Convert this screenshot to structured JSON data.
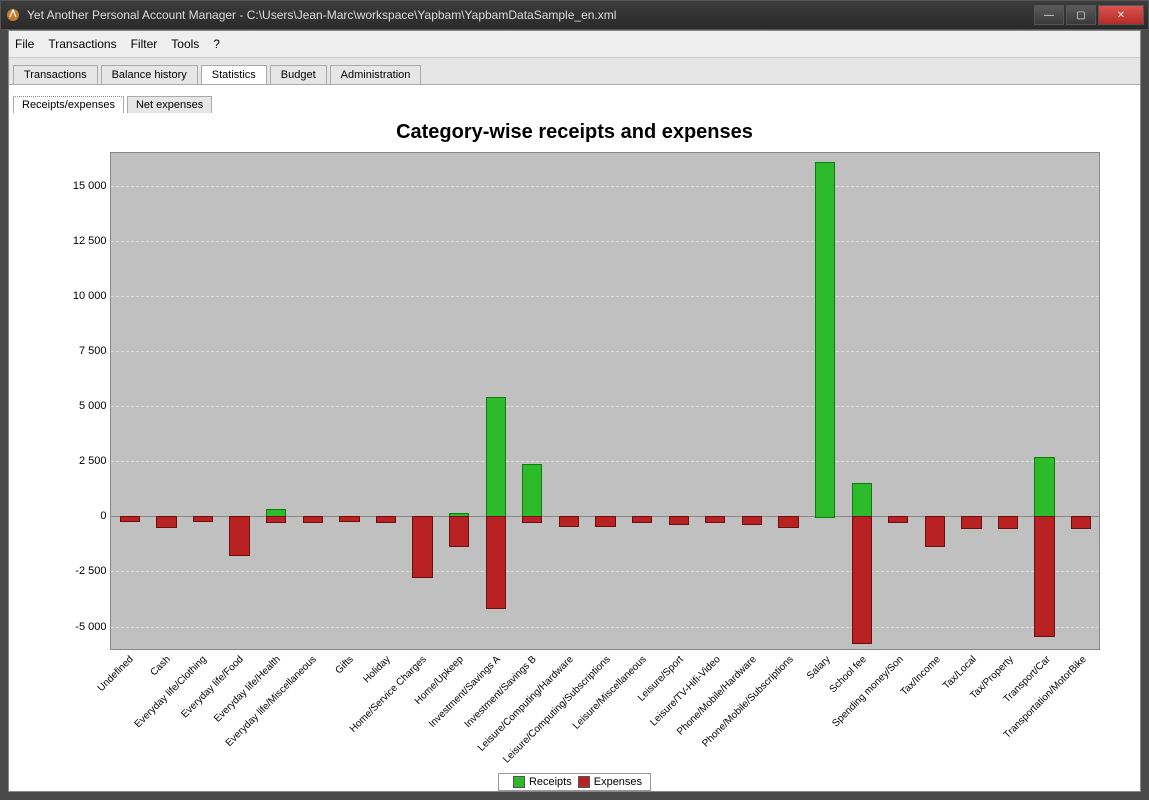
{
  "window": {
    "title": "Yet Another Personal Account Manager - C:\\Users\\Jean-Marc\\workspace\\Yapbam\\YapbamDataSample_en.xml"
  },
  "menu": {
    "file": "File",
    "transactions": "Transactions",
    "filter": "Filter",
    "tools": "Tools",
    "help": "?"
  },
  "tabs": {
    "transactions": "Transactions",
    "balance_history": "Balance history",
    "statistics": "Statistics",
    "budget": "Budget",
    "administration": "Administration"
  },
  "sub_tabs": {
    "receipts_expenses": "Receipts/expenses",
    "net_expenses": "Net expenses"
  },
  "chart": {
    "title": "Category-wise receipts and expenses"
  },
  "legend": {
    "receipts": "Receipts",
    "expenses": "Expenses"
  },
  "yticks": [
    "15 000",
    "12 500",
    "10 000",
    "7 500",
    "5 000",
    "2 500",
    "0",
    "-2 500",
    "-5 000"
  ],
  "chart_data": {
    "type": "bar",
    "title": "Category-wise receipts and expenses",
    "xlabel": "",
    "ylabel": "",
    "ylim": [
      -6000,
      16500
    ],
    "categories": [
      "Undefined",
      "Cash",
      "Everyday life/Clothing",
      "Everyday life/Food",
      "Everyday life/Health",
      "Everyday life/Miscellaneous",
      "Gifts",
      "Holiday",
      "Home/Service Charges",
      "Home/Upkeep",
      "Investment/Savings A",
      "Investment/Savings B",
      "Leisure/Computing/Hardware",
      "Leisure/Computing/Subscriptions",
      "Leisure/Miscellaneous",
      "Leisure/Sport",
      "Leisure/TV-Hifi-Video",
      "Phone/Mobile/Hardware",
      "Phone/Mobile/Subscriptions",
      "Salary",
      "School fee",
      "Spending money/Son",
      "Tax/Income",
      "Tax/Local",
      "Tax/Property",
      "Transport/Car",
      "Transportation/MotorBike"
    ],
    "series": [
      {
        "name": "Receipts",
        "color": "#2dbb2b",
        "values": [
          0,
          0,
          0,
          0,
          350,
          0,
          0,
          0,
          0,
          150,
          5400,
          2400,
          0,
          0,
          0,
          0,
          0,
          0,
          0,
          16100,
          1500,
          0,
          0,
          0,
          0,
          2700,
          0
        ]
      },
      {
        "name": "Expenses",
        "color": "#b92222",
        "values": [
          -150,
          -450,
          -150,
          -1700,
          -200,
          -200,
          -150,
          -200,
          -2700,
          -1300,
          -4100,
          -200,
          -400,
          -400,
          -200,
          -300,
          -200,
          -300,
          -450,
          0,
          -5700,
          -200,
          -1300,
          -500,
          -500,
          -5400,
          -500
        ]
      }
    ]
  }
}
